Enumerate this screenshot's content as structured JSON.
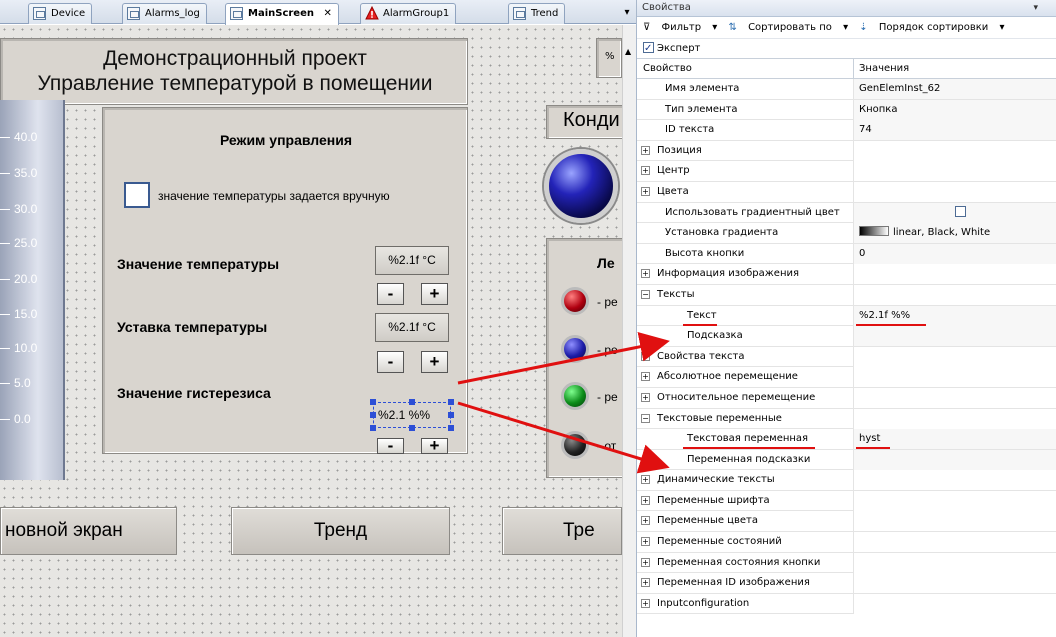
{
  "tabs": [
    {
      "label": "Device"
    },
    {
      "label": "Alarms_log"
    },
    {
      "label": "MainScreen",
      "close": "✕"
    },
    {
      "label": "AlarmGroup1"
    },
    {
      "label": "Trend"
    }
  ],
  "visu": {
    "title_line1": "Демонстрационный проект",
    "title_line2": "Управление температурой в помещении",
    "gauge_ticks": [
      "40.0",
      "35.0",
      "30.0",
      "25.0",
      "20.0",
      "15.0",
      "10.0",
      "5.0",
      "0.0"
    ],
    "control_title": "Режим управления",
    "manual_checkbox_label": "значение температуры задается вручную",
    "temp_value_label": "Значение температуры",
    "temp_value_text": "%2.1f °C",
    "setpoint_label": "Уставка температуры",
    "setpoint_text": "%2.1f °C",
    "hysteresis_label": "Значение гистерезиса",
    "hysteresis_text": "%2.1 %%",
    "minus": "-",
    "plus": "+",
    "conditioner_label": "Конди",
    "legend_title": "Ле",
    "legend_items": [
      {
        "label": "- ре",
        "color": "#b00010"
      },
      {
        "label": "- ре",
        "color": "#1c1ca8"
      },
      {
        "label": "- ре",
        "color": "#0c8c1a"
      },
      {
        "label": "- от",
        "color": "#222222"
      }
    ],
    "nav_main": "новной экран",
    "nav_trend": "Тренд",
    "nav_trend2": "Тре",
    "percent_stub": "%"
  },
  "props": {
    "panel_title": "Свойства",
    "toolbar": {
      "filter": "Фильтр",
      "sort_by": "Сортировать по",
      "sort_order": "Порядок сортировки"
    },
    "expert_label": "Эксперт",
    "col_property": "Свойство",
    "col_values": "Значения",
    "rows": [
      {
        "name": "Имя элемента",
        "value": "GenElemInst_62",
        "type": "prop"
      },
      {
        "name": "Тип элемента",
        "value": "Кнопка",
        "type": "prop"
      },
      {
        "name": "ID текста",
        "value": "74",
        "type": "prop"
      },
      {
        "name": "Позиция",
        "value": "",
        "type": "cat",
        "sign": "+"
      },
      {
        "name": "Центр",
        "value": "",
        "type": "cat",
        "sign": "+"
      },
      {
        "name": "Цвета",
        "value": "",
        "type": "cat",
        "sign": "+"
      },
      {
        "name": "Использовать градиентный цвет",
        "value": "",
        "type": "check"
      },
      {
        "name": "Установка градиента",
        "value": "linear, Black, White",
        "type": "gradient"
      },
      {
        "name": "Высота кнопки",
        "value": "0",
        "type": "prop"
      },
      {
        "name": "Информация изображения",
        "value": "",
        "type": "cat",
        "sign": "+"
      },
      {
        "name": "Тексты",
        "value": "",
        "type": "cat",
        "sign": "−"
      },
      {
        "name": "Текст",
        "value": "%2.1f %%",
        "type": "sub",
        "underline": true
      },
      {
        "name": "Подсказка",
        "value": "",
        "type": "sub"
      },
      {
        "name": "Свойства текста",
        "value": "",
        "type": "cat",
        "sign": "+"
      },
      {
        "name": "Абсолютное перемещение",
        "value": "",
        "type": "cat",
        "sign": "+"
      },
      {
        "name": "Относительное перемещение",
        "value": "",
        "type": "cat",
        "sign": "+"
      },
      {
        "name": "Текстовые переменные",
        "value": "",
        "type": "cat",
        "sign": "−"
      },
      {
        "name": "Текстовая переменная",
        "value": "hyst",
        "type": "sub",
        "underline": true
      },
      {
        "name": "Переменная подсказки",
        "value": "",
        "type": "sub"
      },
      {
        "name": "Динамические тексты",
        "value": "",
        "type": "cat",
        "sign": "+"
      },
      {
        "name": "Переменные шрифта",
        "value": "",
        "type": "cat",
        "sign": "+"
      },
      {
        "name": "Переменные цвета",
        "value": "",
        "type": "cat",
        "sign": "+"
      },
      {
        "name": "Переменные состояний",
        "value": "",
        "type": "cat",
        "sign": "+"
      },
      {
        "name": "Переменная состояния кнопки",
        "value": "",
        "type": "cat",
        "sign": "+"
      },
      {
        "name": "Переменная ID изображения",
        "value": "",
        "type": "cat",
        "sign": "+"
      },
      {
        "name": "Inputconfiguration",
        "value": "",
        "type": "cat",
        "sign": "+"
      }
    ]
  },
  "colors": {
    "annotation_red": "#e01010",
    "selection_blue": "#2d4fd6"
  }
}
